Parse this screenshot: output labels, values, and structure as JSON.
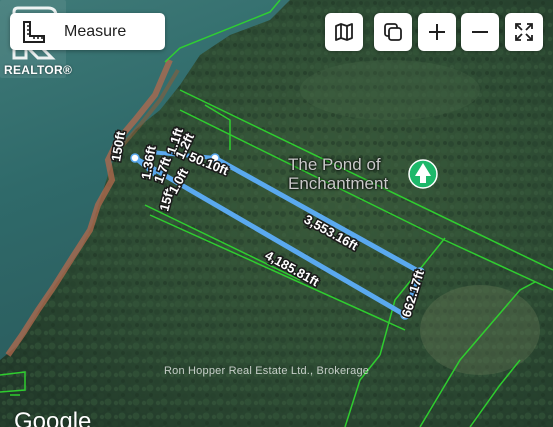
{
  "logo": {
    "text": "REALTOR®",
    "icon": "realtor-r-logo-icon"
  },
  "measure": {
    "label": "Measure",
    "icon": "ruler-icon"
  },
  "controls": [
    {
      "name": "map-type-button",
      "icon": "map-icon"
    },
    {
      "name": "copy-button",
      "icon": "copy-icon"
    },
    {
      "name": "zoom-in-button",
      "icon": "plus-icon"
    },
    {
      "name": "zoom-out-button",
      "icon": "minus-icon"
    },
    {
      "name": "fullscreen-button",
      "icon": "fullscreen-icon"
    }
  ],
  "place": {
    "name_line1": "The Pond of",
    "name_line2": "Enchantment",
    "icon": "tree-pin-icon",
    "pin_color": "#1db86a"
  },
  "measurements": {
    "top_line": "3,553.16ft",
    "bottom_line": "4,185.81ft",
    "right_segment": "662.17ft",
    "top_left_segment": "50.10ft",
    "cluster": [
      "150ft",
      "1.36ft",
      "1.7ft",
      "15ft",
      "1.1ft",
      "1.2ft",
      "1.0ft"
    ]
  },
  "attribution": {
    "brokerage": "Ron Hopper Real Estate Ltd., Brokerage",
    "provider": "Google"
  },
  "colors": {
    "measure_line": "#5aa9ef",
    "parcel_outline": "#2fd42f"
  }
}
